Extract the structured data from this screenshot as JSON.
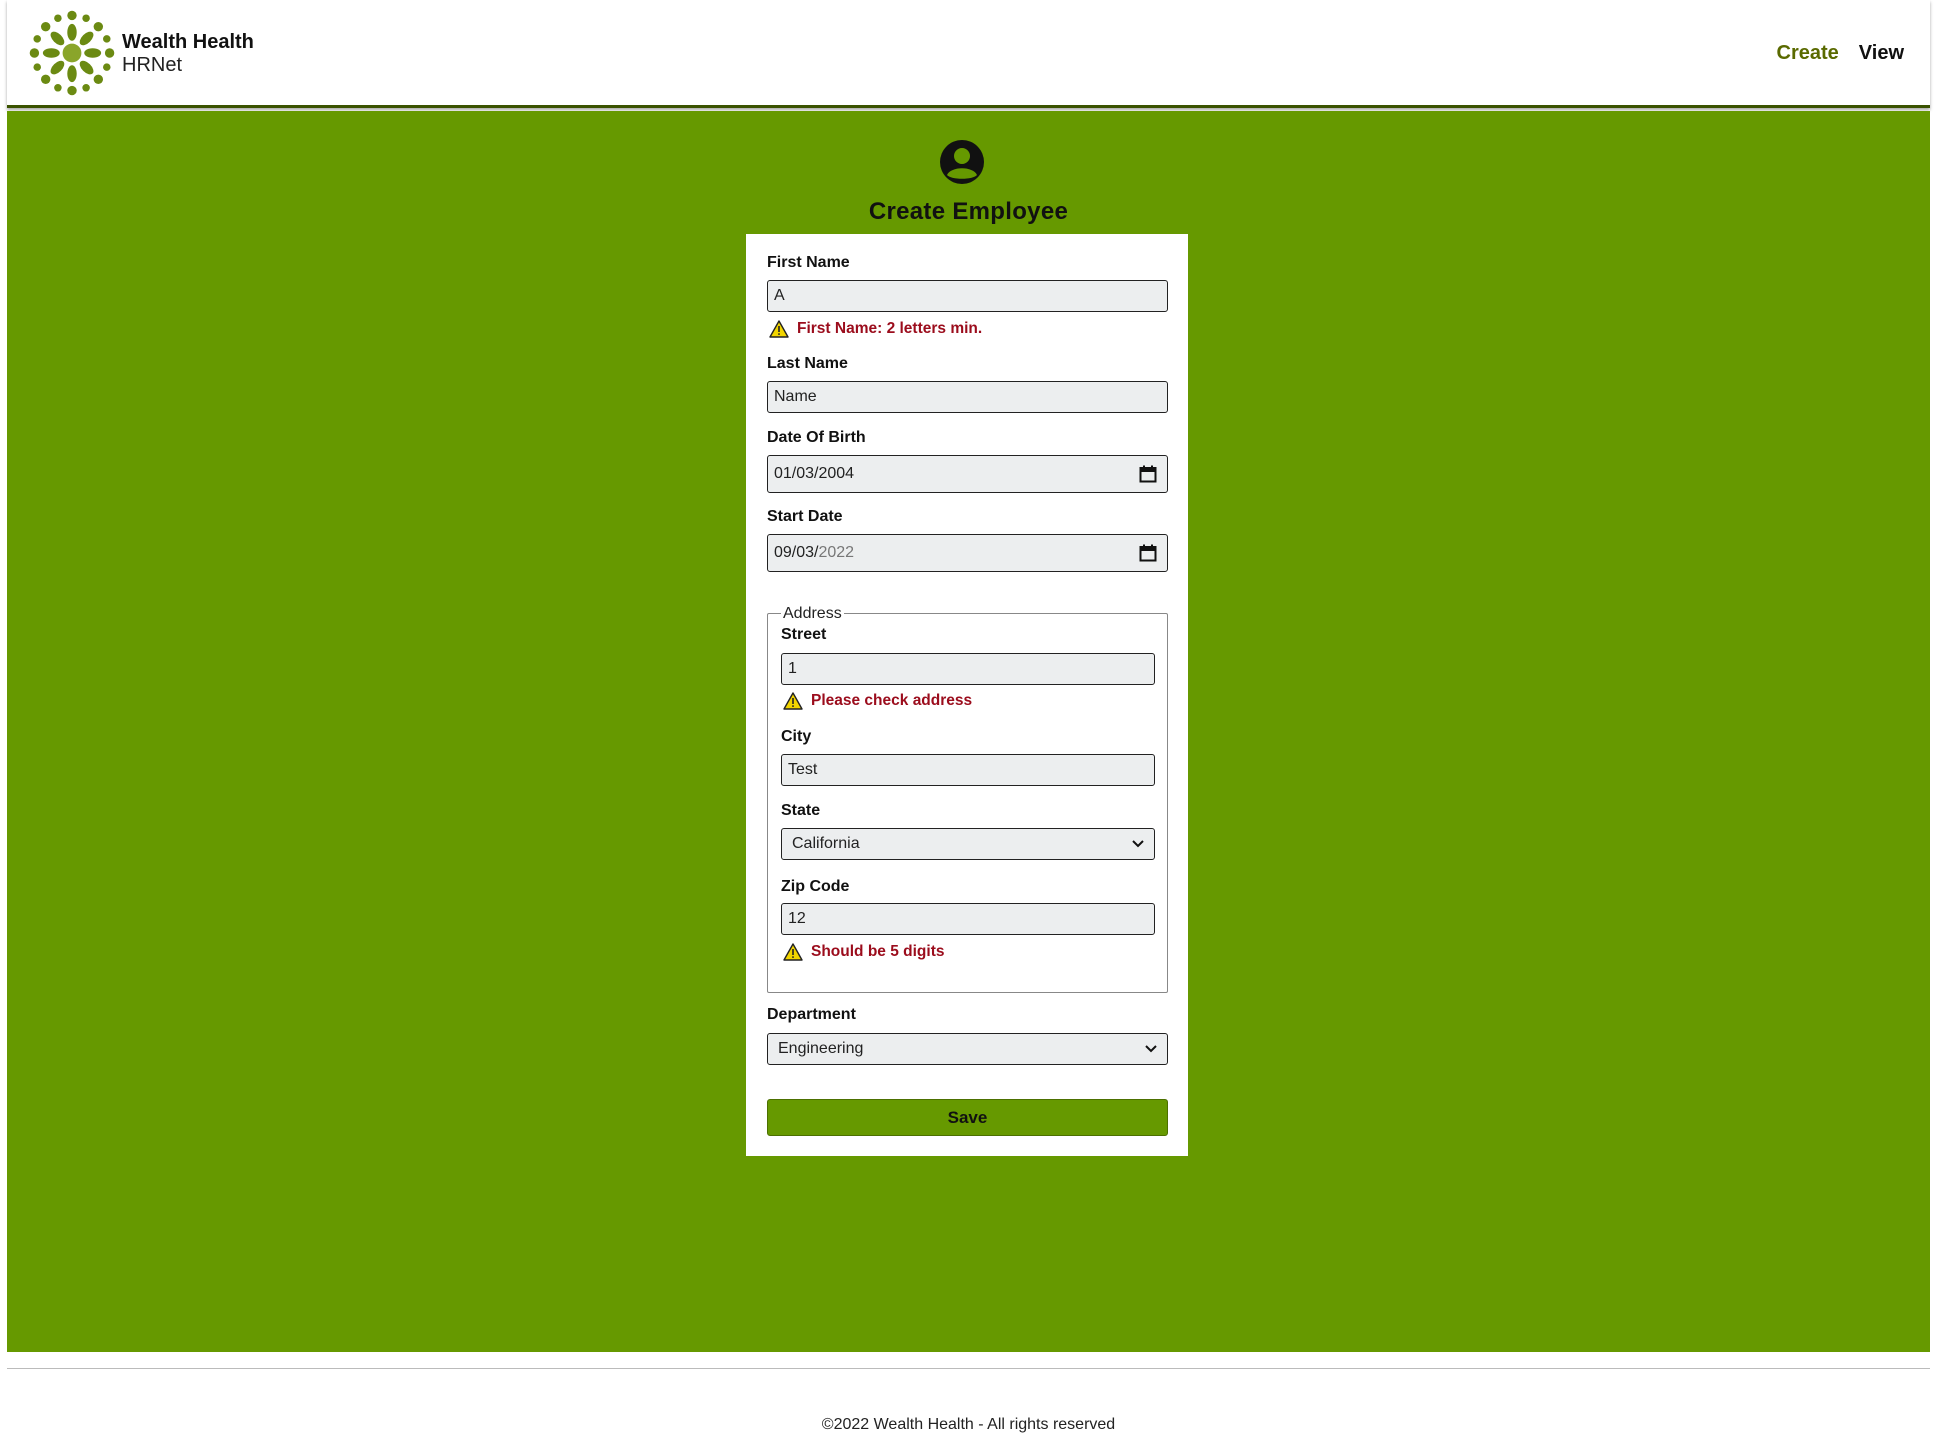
{
  "brand": {
    "name": "Wealth Health",
    "subtitle": "HRNet",
    "accent_color": "#669900",
    "icon": "sun-flower-logo"
  },
  "nav": {
    "create": "Create",
    "view": "View"
  },
  "page": {
    "title": "Create Employee",
    "icon": "user-circle-icon"
  },
  "form": {
    "first_name": {
      "label": "First Name",
      "value": "A",
      "error": "First Name: 2 letters min."
    },
    "last_name": {
      "label": "Last Name",
      "value": "Name"
    },
    "date_of_birth": {
      "label": "Date Of Birth",
      "value": "01/03/2004"
    },
    "start_date": {
      "label": "Start Date",
      "value_entered": "09/03/",
      "value_placeholder": "2022"
    },
    "address": {
      "legend": "Address",
      "street": {
        "label": "Street",
        "value": "1",
        "error": "Please check address"
      },
      "city": {
        "label": "City",
        "value": "Test"
      },
      "state": {
        "label": "State",
        "value": "California"
      },
      "zip": {
        "label": "Zip Code",
        "value": "12",
        "error": "Should be 5 digits"
      }
    },
    "department": {
      "label": "Department",
      "value": "Engineering"
    },
    "save_label": "Save"
  },
  "footer": {
    "text": "©2022 Wealth Health - All rights reserved"
  },
  "colors": {
    "error": "#9b0c1c",
    "warning_icon": "#f2d500"
  }
}
